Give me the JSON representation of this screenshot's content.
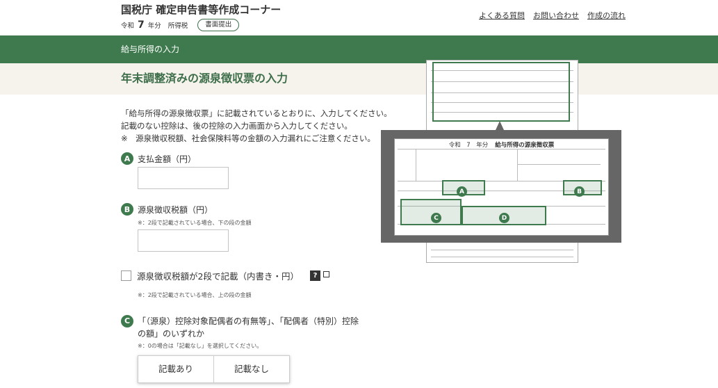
{
  "header": {
    "site_title": "国税庁 確定申告書等作成コーナー",
    "era": "令和",
    "year": "7",
    "year_unit": "年分",
    "tax_type": "所得税",
    "submit_label": "書面提出",
    "links": [
      "よくある質問",
      "お問い合わせ",
      "作成の流れ"
    ]
  },
  "section_bar": "給与所得の入力",
  "page_title": "年末調整済みの源泉徴収票の入力",
  "intro": [
    "「給与所得の源泉徴収票」に記載されているとおりに、入力してください。",
    "記載のない控除は、後の控除の入力画面から入力してください。",
    "※　源泉徴収税額、社会保険料等の金額の入力漏れにご注意ください。"
  ],
  "fields": {
    "a": {
      "marker": "A",
      "label": "支払金額（円）",
      "value": ""
    },
    "b": {
      "marker": "B",
      "label": "源泉徴収税額（円）",
      "note": "※：2段で記載されている場合、下の段の金額",
      "value": ""
    },
    "two_row": {
      "label": "源泉徴収税額が2段で記載（内書き・円）",
      "help": "?",
      "note": "※：2段で記載されている場合、上の段の金額",
      "checked": false
    },
    "c": {
      "marker": "C",
      "label": "「（源泉）控除対象配偶者の有無等」、「配偶者（特別）控除の額」のいずれか",
      "note": "※：0の場合は「記載なし」を選択してください。",
      "options": [
        "記載あり",
        "記載なし"
      ]
    }
  },
  "figure": {
    "title_era": "令和　7　年分",
    "title": "給与所得の源泉徴収票",
    "markers": [
      "A",
      "B",
      "C",
      "D"
    ]
  },
  "colors": {
    "accent": "#3e7a4d",
    "title_bg": "#f5f3ec"
  }
}
